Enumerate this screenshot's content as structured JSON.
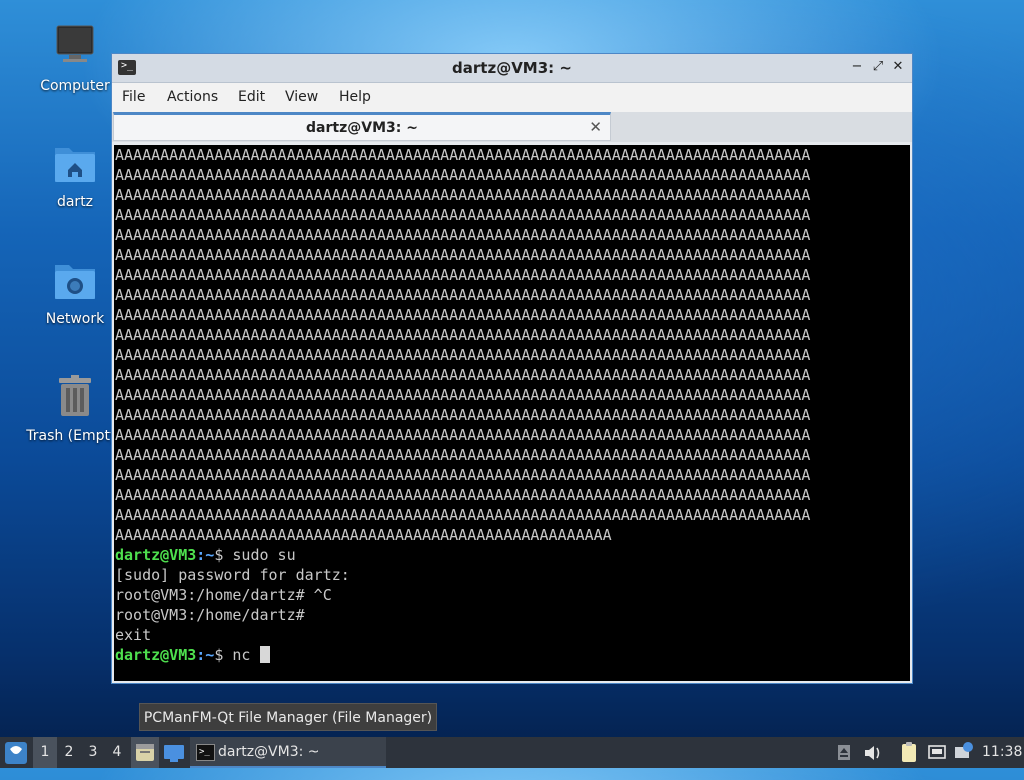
{
  "desktop": {
    "icons": [
      {
        "label": "Computer",
        "icon": "computer-icon"
      },
      {
        "label": "dartz",
        "icon": "home-folder-icon"
      },
      {
        "label": "Network",
        "icon": "network-folder-icon"
      },
      {
        "label": "Trash (Empty)",
        "icon": "trash-icon"
      }
    ]
  },
  "window": {
    "title": "dartz@VM3: ~",
    "icon": "terminal-icon",
    "controls": {
      "minimize": "−",
      "maximize": "⤢",
      "close": "✕"
    },
    "menu": [
      "File",
      "Actions",
      "Edit",
      "View",
      "Help"
    ],
    "tab": {
      "label": "dartz@VM3: ~",
      "close": "✕"
    }
  },
  "terminal": {
    "a_line": "AAAAAAAAAAAAAAAAAAAAAAAAAAAAAAAAAAAAAAAAAAAAAAAAAAAAAAAAAAAAAAAAAAAAAAAAAAAAA",
    "a_line_count": 19,
    "a_last": "AAAAAAAAAAAAAAAAAAAAAAAAAAAAAAAAAAAAAAAAAAAAAAAAAAAAAAA",
    "prompt_user": "dartz@VM3",
    "prompt_path": ":~",
    "prompt_sign": "$ ",
    "cmd1": "sudo su",
    "sudo_line": "[sudo] password for dartz:",
    "root1": "root@VM3:/home/dartz# ^C",
    "root2": "root@VM3:/home/dartz#",
    "exit": "exit",
    "cmd2": "nc "
  },
  "tooltip": "PCManFM-Qt File Manager (File Manager)",
  "taskbar": {
    "start_icon": "lxqt-menu-icon",
    "workspaces": [
      "1",
      "2",
      "3",
      "4"
    ],
    "active_workspace": "1",
    "quicklaunch": [
      "file-manager-icon",
      "show-desktop-icon"
    ],
    "task_label": "dartz@VM3: ~",
    "tray": [
      "eject-icon",
      "volume-icon",
      "clipboard-icon",
      "network-icon",
      "update-icon"
    ],
    "clock": "11:38"
  }
}
